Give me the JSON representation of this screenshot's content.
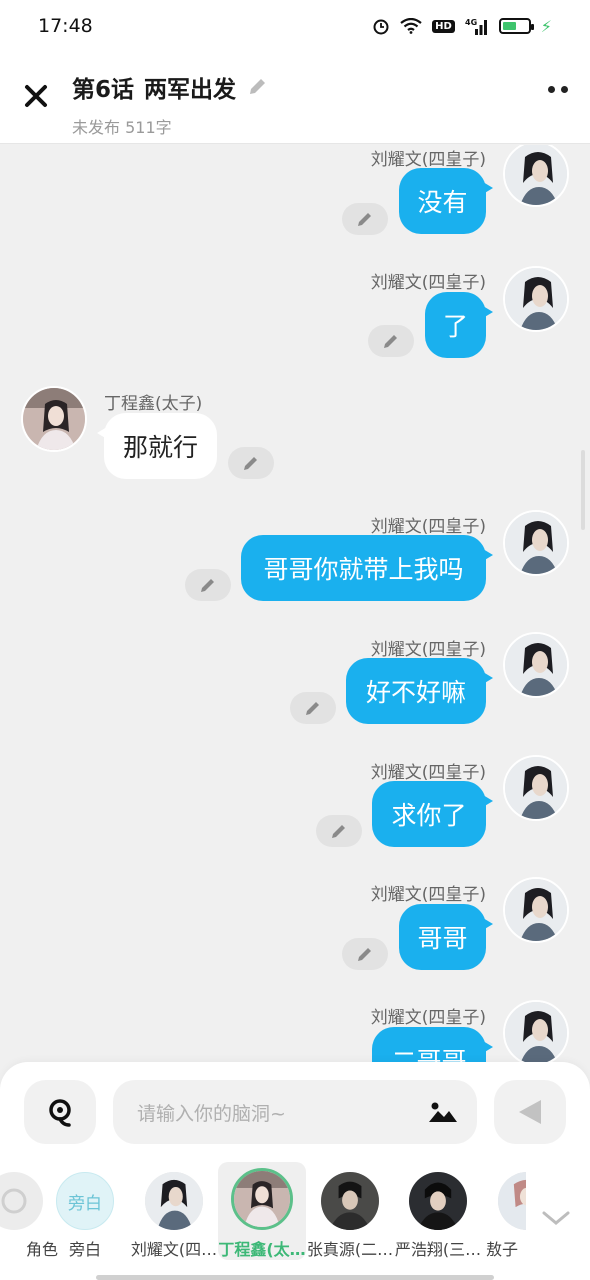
{
  "status_bar": {
    "time": "17:48",
    "network": "4G",
    "hd": "HD"
  },
  "header": {
    "episode": "第6话",
    "title": "两军出发",
    "subtitle": "未发布 511字"
  },
  "messages": [
    {
      "side": "right",
      "name": "刘耀文(四皇子)",
      "text": "没有"
    },
    {
      "side": "right",
      "name": "刘耀文(四皇子)",
      "text": "了"
    },
    {
      "side": "left",
      "name": "丁程鑫(太子)",
      "text": "那就行"
    },
    {
      "side": "right",
      "name": "刘耀文(四皇子)",
      "text": "哥哥你就带上我吗"
    },
    {
      "side": "right",
      "name": "刘耀文(四皇子)",
      "text": "好不好嘛"
    },
    {
      "side": "right",
      "name": "刘耀文(四皇子)",
      "text": "求你了"
    },
    {
      "side": "right",
      "name": "刘耀文(四皇子)",
      "text": "哥哥"
    },
    {
      "side": "right",
      "name": "刘耀文(四皇子)",
      "text": "二哥哥"
    }
  ],
  "input": {
    "placeholder": "请输入你的脑洞~"
  },
  "characters": [
    {
      "label": "角色",
      "type": "add"
    },
    {
      "label": "旁白",
      "avatar_text": "旁白",
      "type": "narrator"
    },
    {
      "label": "刘耀文(四…",
      "type": "person"
    },
    {
      "label": "丁程鑫(太…",
      "type": "person",
      "selected": true
    },
    {
      "label": "张真源(二…",
      "type": "person"
    },
    {
      "label": "严浩翔(三…",
      "type": "person"
    },
    {
      "label": "敖子",
      "type": "person"
    }
  ],
  "colors": {
    "bubble_blue": "#1ab0ee",
    "selected_green": "#3db877",
    "background": "#f0f0f0"
  },
  "icons": {
    "close": "close-icon",
    "edit": "pencil-icon",
    "more": "more-dots-icon",
    "voice": "voice-icon",
    "image": "image-icon",
    "send": "send-icon",
    "expand": "chevron-down-icon"
  }
}
